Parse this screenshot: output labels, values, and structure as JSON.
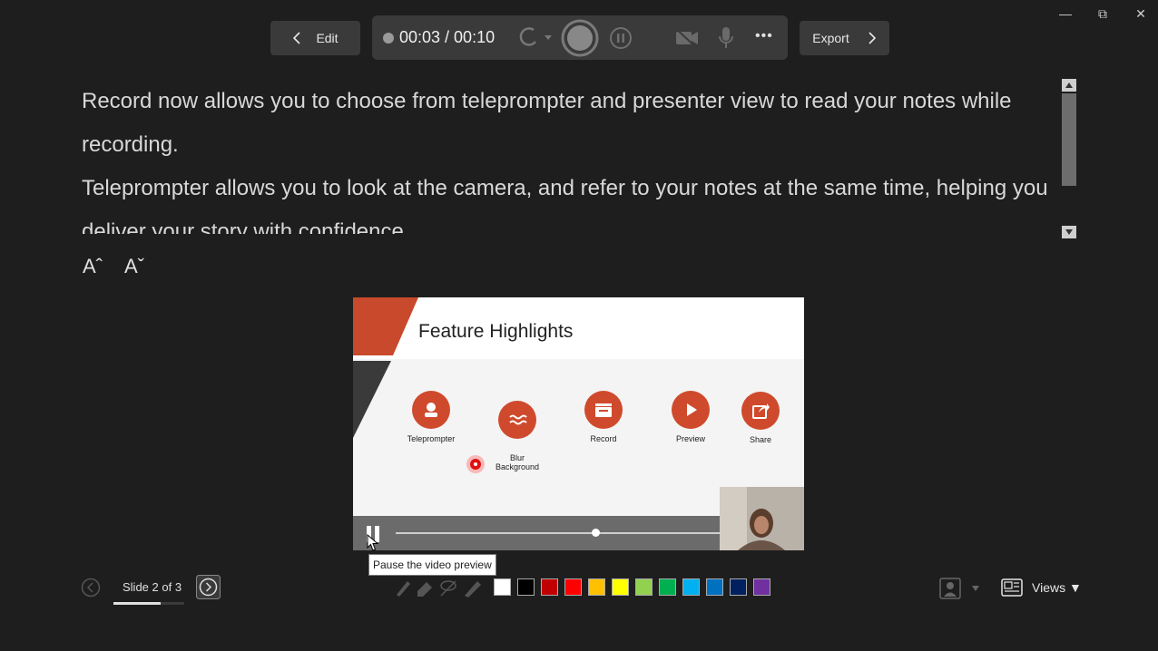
{
  "window": {
    "minimize": "—",
    "restore": "⧉",
    "close": "✕"
  },
  "toolbar": {
    "edit_label": "Edit",
    "export_label": "Export",
    "timer": "00:03 / 00:10",
    "more": "•••"
  },
  "notes": {
    "paragraphs": [
      "Record now allows you to choose from teleprompter and presenter view to read your notes while recording.",
      "Teleprompter allows you to look at the camera, and refer to your notes at the same time, helping you deliver your story with confidence."
    ],
    "font_increase": "Aˆ",
    "font_decrease": "Aˇ"
  },
  "slide": {
    "title": "Feature Highlights",
    "features": [
      {
        "label": "Teleprompter",
        "icon": "teleprompter-icon"
      },
      {
        "label": "Blur\nBackground",
        "icon": "blur-icon"
      },
      {
        "label": "Record",
        "icon": "record-clapper-icon"
      },
      {
        "label": "Preview",
        "icon": "play-icon"
      },
      {
        "label": "Share",
        "icon": "share-icon"
      }
    ],
    "video_progress": 0.58
  },
  "tooltip": "Pause the video preview",
  "bottom": {
    "slide_counter": "Slide 2 of 3",
    "colors": [
      "#ffffff",
      "#000000",
      "#c00000",
      "#ff0000",
      "#ffc000",
      "#ffff00",
      "#92d050",
      "#00b050",
      "#00b0f0",
      "#0070c0",
      "#002060",
      "#7030a0"
    ],
    "views_label": "Views ▼"
  },
  "accent_color": "#cf4a2c"
}
